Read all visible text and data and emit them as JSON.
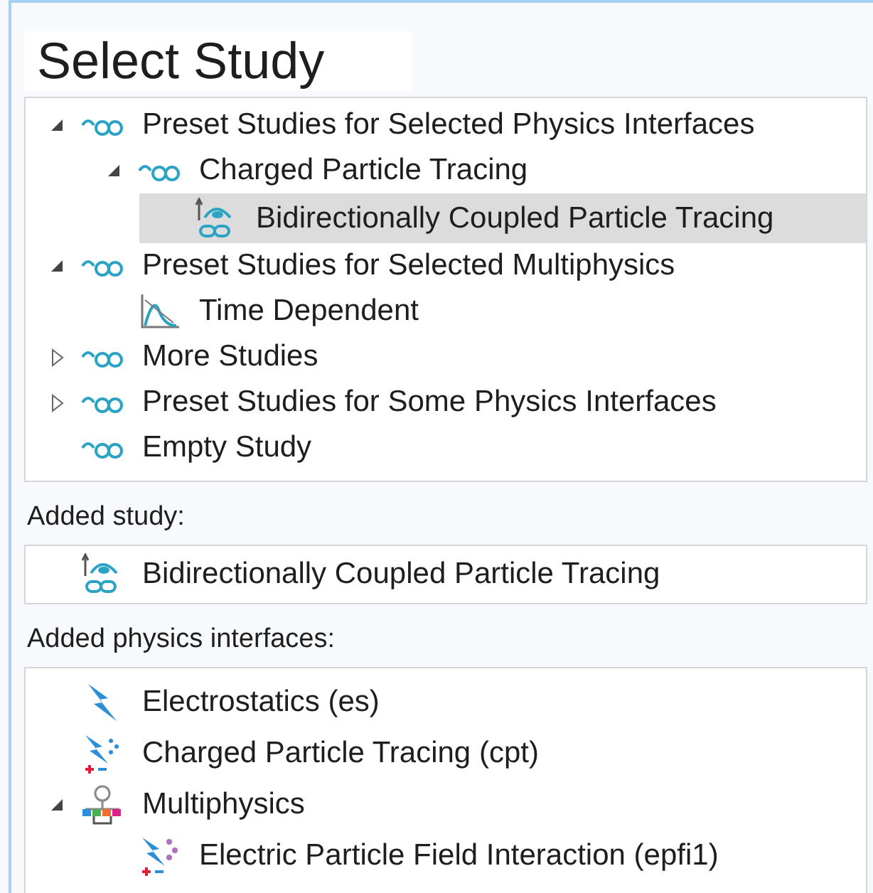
{
  "title": "Select Study",
  "studies": [
    {
      "label": "Preset Studies for Selected Physics Interfaces",
      "kind": "group",
      "expanded": true,
      "selected": false,
      "children": [
        {
          "label": "Charged Particle Tracing",
          "kind": "group",
          "expanded": true,
          "selected": false,
          "children": [
            {
              "label": "Bidirectionally Coupled Particle Tracing",
              "kind": "coupled",
              "selected": true
            }
          ]
        }
      ]
    },
    {
      "label": "Preset Studies for Selected Multiphysics",
      "kind": "group",
      "expanded": true,
      "selected": false,
      "children": [
        {
          "label": "Time Dependent",
          "kind": "time",
          "selected": false
        }
      ]
    },
    {
      "label": "More Studies",
      "kind": "group",
      "expanded": false,
      "selected": false
    },
    {
      "label": "Preset Studies for Some Physics Interfaces",
      "kind": "group",
      "expanded": false,
      "selected": false
    },
    {
      "label": "Empty Study",
      "kind": "group",
      "selected": false
    }
  ],
  "added_study_label": "Added study:",
  "added_study": {
    "label": "Bidirectionally Coupled Particle Tracing",
    "kind": "coupled"
  },
  "added_physics_label": "Added physics interfaces:",
  "physics": [
    {
      "label": "Electrostatics (es)",
      "kind": "electrostatics"
    },
    {
      "label": "Charged Particle Tracing (cpt)",
      "kind": "particles"
    },
    {
      "label": "Multiphysics",
      "kind": "multiphysics",
      "expanded": true,
      "children": [
        {
          "label": "Electric Particle Field Interaction (epfi1)",
          "kind": "field"
        }
      ]
    }
  ]
}
